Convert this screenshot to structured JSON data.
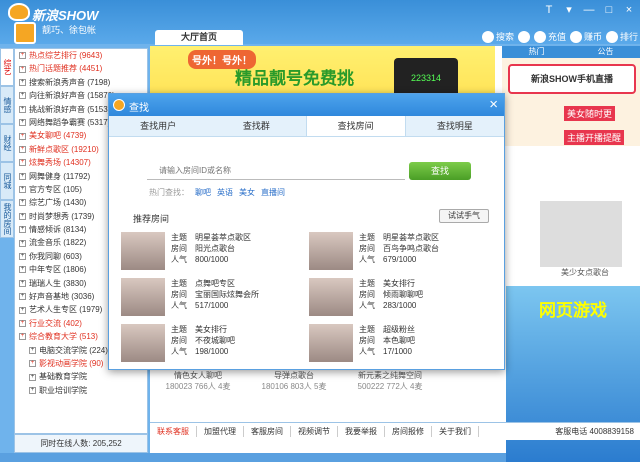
{
  "app": {
    "title": "新浪SHOW",
    "username": "靓巧、徐包帐"
  },
  "window_buttons": [
    "T",
    "▾",
    "—",
    "□",
    "×"
  ],
  "main_tab": "大厅首页",
  "toptools": [
    {
      "label": "搜索",
      "icon": "search-icon"
    },
    {
      "label": "",
      "icon": "panda-icon"
    },
    {
      "label": "充值",
      "icon": "coin-icon"
    },
    {
      "label": "赚币",
      "icon": "earn-icon"
    },
    {
      "label": "排行",
      "icon": "rank-icon"
    }
  ],
  "vtabs": [
    "综艺",
    "情感",
    "财经",
    "同城",
    "我的房间"
  ],
  "rooms": [
    {
      "label": "热点综艺排行 (9643)",
      "red": true
    },
    {
      "label": "热门话题推荐 (4451)",
      "red": true
    },
    {
      "label": "搜索新浪秀声音 (7198)",
      "red": false
    },
    {
      "label": "向往新浪好声音 (15870)",
      "red": false
    },
    {
      "label": "挑战新浪好声音 (5153)",
      "red": false
    },
    {
      "label": "网络舞蹈争霸赛 (5317)",
      "red": false
    },
    {
      "label": "美女聊吧 (4739)",
      "red": true
    },
    {
      "label": "新鲜点歌区 (19210)",
      "red": true
    },
    {
      "label": "炫舞秀场 (14307)",
      "red": true
    },
    {
      "label": "网舞健身 (11792)",
      "red": false
    },
    {
      "label": "官方专区 (105)",
      "red": false
    },
    {
      "label": "综艺广场 (1430)",
      "red": false
    },
    {
      "label": "时尚梦想秀 (1739)",
      "red": false
    },
    {
      "label": "情感倾诉 (8134)",
      "red": false
    },
    {
      "label": "流金音乐 (1822)",
      "red": false
    },
    {
      "label": "你我同聊 (603)",
      "red": false
    },
    {
      "label": "中年专区 (1806)",
      "red": false
    },
    {
      "label": "瑞瑞人生 (3830)",
      "red": false
    },
    {
      "label": "好声音基地 (3036)",
      "red": false
    },
    {
      "label": "艺术人生专区 (1979)",
      "red": false
    },
    {
      "label": "行业交流 (402)",
      "red": true
    },
    {
      "label": "综合教育大学 (513)",
      "red": true
    },
    {
      "label": "电脑交流学院 (224)",
      "red": false,
      "sub": true
    },
    {
      "label": "影视动画学院 (90)",
      "red": true,
      "sub": true
    },
    {
      "label": "基础教育学院",
      "red": false,
      "sub": true
    },
    {
      "label": "职业培训学院",
      "red": false,
      "sub": true
    }
  ],
  "online_text": "同时在线人数: 205,252",
  "banner": {
    "line1": "号外！号外！",
    "line2": "精品靓号免费挑",
    "phone_text": "223314"
  },
  "sidepanel": {
    "tabs": [
      "热门",
      "公告"
    ],
    "ad": "新浪SHOW手机直播",
    "promo1": "美女随时更",
    "promo2": "主播开播提醒"
  },
  "thumbs": [
    "美少女点歌台"
  ],
  "game_ad": {
    "title": "网页游戏"
  },
  "bottom_cards": [
    {
      "name": "情色女人聊吧",
      "stat": "180023 766人 4麦"
    },
    {
      "name": "导弹点歌台",
      "stat": "180106 803人 5麦"
    },
    {
      "name": "新元素之纯舞空间",
      "stat": "500222 772人 4麦"
    }
  ],
  "bottomnav": [
    {
      "label": "联系客服",
      "red": true
    },
    {
      "label": "加盟代理",
      "red": false
    },
    {
      "label": "客服房间",
      "red": false
    },
    {
      "label": "视频调节",
      "red": false
    },
    {
      "label": "我要举报",
      "red": false
    },
    {
      "label": "房间报修",
      "red": false
    },
    {
      "label": "关于我们",
      "red": false
    }
  ],
  "bottom_phone": "客服电话 4008839158",
  "dialog": {
    "title": "查找",
    "tabs": [
      "查找用户",
      "查找群",
      "查找房间",
      "查找明星"
    ],
    "active_tab": 2,
    "search_placeholder": "请输入房间ID或名称",
    "search_button": "查找",
    "hot_label": "热门查找：",
    "hot_links": [
      "聊吧",
      "英语",
      "美女",
      "直播间"
    ],
    "rec_title": "推荐房间",
    "try_button": "试试手气",
    "labels": {
      "topic": "主题",
      "room": "房间",
      "pop": "人气"
    },
    "rooms": [
      {
        "topic": "明星荟萃点歌区",
        "room": "阳光点歌台",
        "pop": "800/1000"
      },
      {
        "topic": "明星荟萃点歌区",
        "room": "百鸟争鸣点歌台",
        "pop": "679/1000"
      },
      {
        "topic": "点舞吧专区",
        "room": "宝丽国际炫舞会所",
        "pop": "517/1000"
      },
      {
        "topic": "美女排行",
        "room": "倾雨聊聊吧",
        "pop": "283/1000"
      },
      {
        "topic": "美女排行",
        "room": "不夜城聊吧",
        "pop": "198/1000"
      },
      {
        "topic": "超级粉丝",
        "room": "本色聊吧",
        "pop": "17/1000"
      }
    ]
  }
}
